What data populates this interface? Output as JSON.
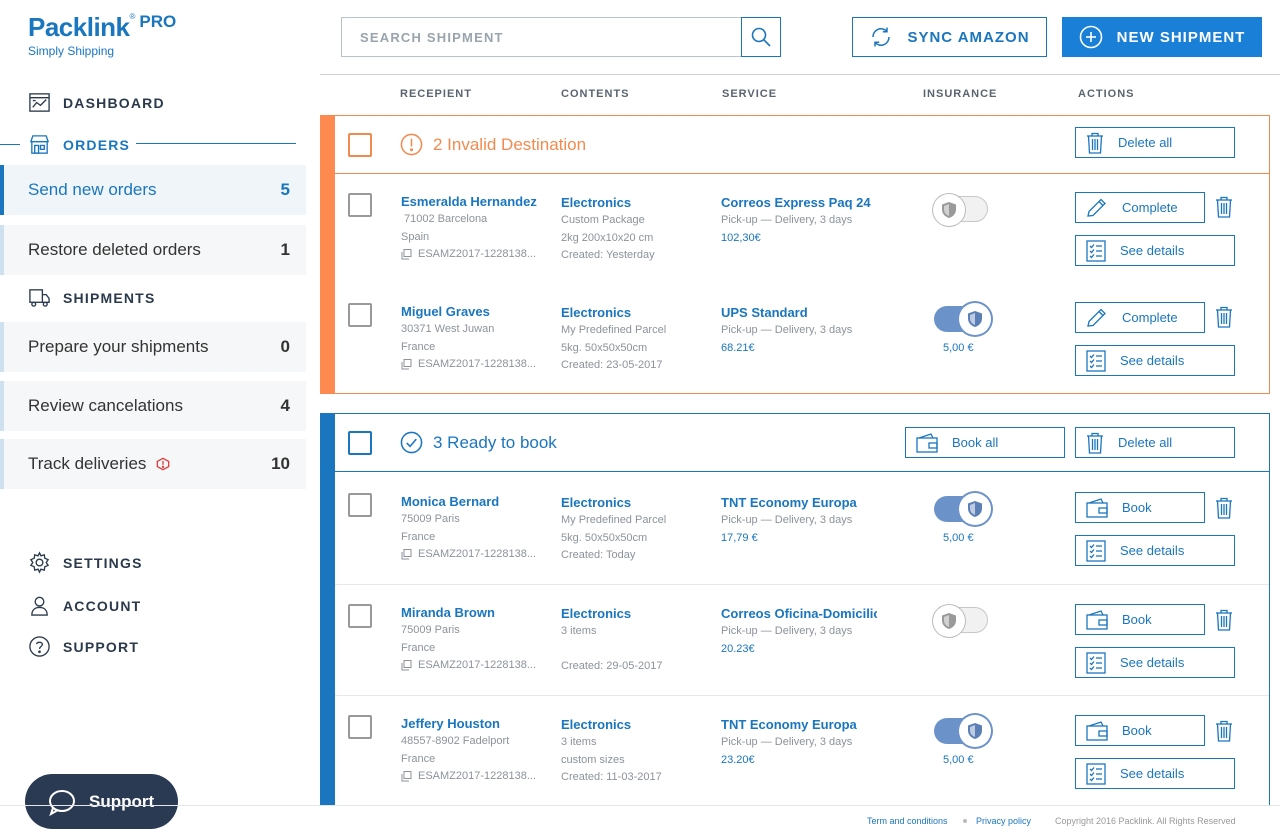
{
  "brand": {
    "name": "Packlink",
    "reg": "®",
    "pro": "PRO",
    "tagline": "Simply Shipping"
  },
  "sidebar": {
    "dashboard": "DASHBOARD",
    "orders": "ORDERS",
    "order_items": [
      {
        "label": "Send new orders",
        "count": "5"
      },
      {
        "label": "Restore deleted orders",
        "count": "1"
      }
    ],
    "shipments": "SHIPMENTS",
    "shipment_items": [
      {
        "label": "Prepare your shipments",
        "count": "0"
      },
      {
        "label": "Review cancelations",
        "count": "4"
      },
      {
        "label": "Track deliveries",
        "count": "10"
      }
    ],
    "settings": "SETTINGS",
    "account": "ACCOUNT",
    "support": "SUPPORT",
    "support_button": "Support"
  },
  "header": {
    "search_placeholder": "SEARCH SHIPMENT",
    "sync_label": "SYNC AMAZON",
    "new_label": "NEW SHIPMENT"
  },
  "columns": {
    "recipient": "RECEPIENT",
    "contents": "CONTENTS",
    "service": "SERVICE",
    "insurance": "INSURANCE",
    "actions": "ACTIONS"
  },
  "invalid_group": {
    "title": "2 Invalid Destination",
    "delete_all": "Delete all",
    "rows": [
      {
        "name": "Esmeralda Hernandez",
        "address": "71002  Barcelona",
        "country": "Spain",
        "ref": "ESAMZ2017-1228138...",
        "content": "Electronics",
        "c1": "Custom Package",
        "c2": "2kg 200x10x20 cm",
        "c3": "Created: Yesterday",
        "service": "Correos Express Paq 24",
        "s1": "Pick-up — Delivery, 3 days",
        "price": "102,30€",
        "insured": false,
        "insurance": "",
        "action": "Complete",
        "details": "See details"
      },
      {
        "name": "Miguel Graves",
        "address": "30371  West Juwan",
        "country": "France",
        "ref": "ESAMZ2017-1228138...",
        "content": "Electronics",
        "c1": "My Predefined Parcel",
        "c2": "5kg. 50x50x50cm",
        "c3": "Created: 23-05-2017",
        "service": "UPS Standard",
        "s1": "Pick-up — Delivery, 3 days",
        "price": "68.21€",
        "insured": true,
        "insurance": "5,00 €",
        "action": "Complete",
        "details": "See details"
      }
    ]
  },
  "ready_group": {
    "title": "3 Ready to book",
    "book_all": "Book all",
    "delete_all": "Delete all",
    "rows": [
      {
        "name": "Monica Bernard",
        "address": "75009  Paris",
        "country": "France",
        "ref": "ESAMZ2017-1228138...",
        "content": "Electronics",
        "c1": "My Predefined Parcel",
        "c2": "5kg. 50x50x50cm",
        "c3": "Created: Today",
        "service": "TNT Economy Europa",
        "s1": "Pick-up — Delivery, 3 days",
        "price": "17,79 €",
        "insured": true,
        "insurance": "5,00 €",
        "action": "Book",
        "details": "See details"
      },
      {
        "name": "Miranda Brown",
        "address": "75009  Paris",
        "country": "France",
        "ref": "ESAMZ2017-1228138...",
        "content": "Electronics",
        "c1": "3 items",
        "c2": "",
        "c3": "Created: 29-05-2017",
        "service": "Correos Oficina-Domicilio",
        "s1": "Pick-up — Delivery, 3 days",
        "price": "20.23€",
        "insured": false,
        "insurance": "",
        "action": "Book",
        "details": "See details"
      },
      {
        "name": "Jeffery Houston",
        "address": "48557-8902  Fadelport",
        "country": "France",
        "ref": "ESAMZ2017-1228138...",
        "content": "Electronics",
        "c1": "3 items",
        "c2": "custom sizes",
        "c3": "Created: 11-03-2017",
        "service": "TNT Economy Europa",
        "s1": "Pick-up — Delivery, 3 days",
        "price": "23.20€",
        "insured": true,
        "insurance": "5,00 €",
        "action": "Book",
        "details": "See details"
      }
    ]
  },
  "footer": {
    "terms": "Term and conditions",
    "privacy": "Privacy policy",
    "copyright": "Copyright 2016 Packlink. All Rights Reserved"
  },
  "colors": {
    "primary": "#1a76bf",
    "warning": "#ff8a50",
    "dark": "#2b3a53"
  }
}
